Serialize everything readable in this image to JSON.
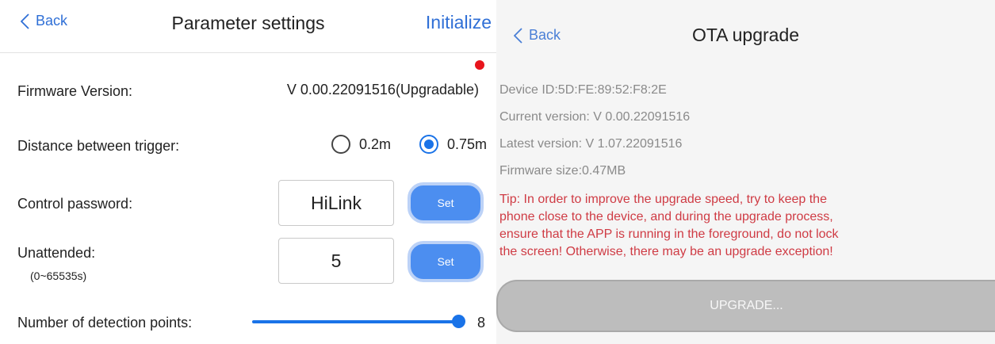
{
  "param_settings": {
    "nav": {
      "back_label": "Back",
      "title": "Parameter settings",
      "action_label": "Initialize"
    },
    "firmware": {
      "label": "Firmware Version:",
      "value": "V 0.00.22091516(Upgradable)",
      "update_available": true
    },
    "distance": {
      "label": "Distance between trigger:",
      "options": [
        {
          "label": "0.2m",
          "selected": false
        },
        {
          "label": "0.75m",
          "selected": true
        }
      ]
    },
    "password": {
      "label": "Control password:",
      "value": "HiLink",
      "button_label": "Set"
    },
    "unattended": {
      "label": "Unattended:",
      "range_hint": "(0~65535s)",
      "value": "5",
      "button_label": "Set"
    },
    "detection_points": {
      "label": "Number of detection points:",
      "value": "8",
      "slider_fraction": 1.0
    }
  },
  "ota_upgrade": {
    "nav": {
      "back_label": "Back",
      "title": "OTA upgrade"
    },
    "device_id": "Device ID:5D:FE:89:52:F8:2E",
    "current_version": "Current version: V 0.00.22091516",
    "latest_version": "Latest version: V 1.07.22091516",
    "firmware_size": "Firmware size:0.47MB",
    "tip_lines": [
      "Tip: In order to improve the upgrade speed, try to keep the",
      "phone close to the device, and during the upgrade process,",
      "ensure that the APP is running in the foreground, do not lock",
      "the screen! Otherwise, there may be an upgrade exception!"
    ],
    "upgrade_button_label": "UPGRADE..."
  },
  "colors": {
    "accent": "#1a73e8",
    "set_button": "#4c8ef0",
    "alert_dot": "#e8141c",
    "tip_text": "#cf3b44",
    "disabled_button": "#bdbdbd"
  },
  "icons": {
    "back": "chevron-left-icon"
  }
}
